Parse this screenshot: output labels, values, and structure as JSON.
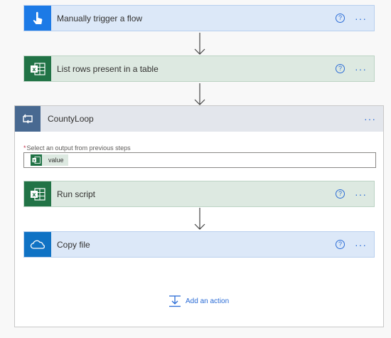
{
  "steps": {
    "trigger": {
      "title": "Manually trigger a flow",
      "help": "?",
      "more": "···"
    },
    "list_rows": {
      "title": "List rows present in a table",
      "help": "?",
      "more": "···"
    }
  },
  "loop": {
    "title": "CountyLoop",
    "more": "···",
    "select_label": "Select an output from previous steps",
    "required_mark": "*",
    "token_value": "value",
    "actions": [
      {
        "title": "Run script",
        "help": "?",
        "more": "···"
      },
      {
        "title": "Copy file",
        "help": "?",
        "more": "···"
      }
    ],
    "add_action_label": "Add an action"
  },
  "colors": {
    "accent": "#2b6cd6",
    "excel_green": "#217346",
    "trigger_blue": "#1c7ae6",
    "onedrive_blue": "#0f72c4",
    "loop_header": "#486991"
  },
  "icons": {
    "trigger": "touch-hand-icon",
    "excel": "excel-icon",
    "loop": "loop-icon",
    "onedrive": "onedrive-cloud-icon",
    "add": "add-action-icon"
  }
}
